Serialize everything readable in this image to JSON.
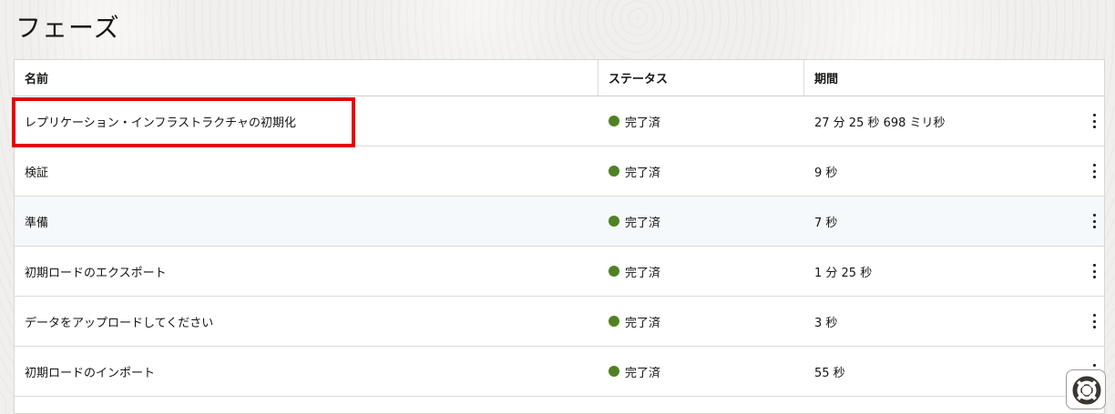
{
  "page": {
    "title": "フェーズ"
  },
  "table": {
    "columns": {
      "name": "名前",
      "status": "ステータス",
      "duration": "期間"
    },
    "rows": [
      {
        "name": "レプリケーション・インフラストラクチャの初期化",
        "status": "完了済",
        "duration": "27 分 25 秒 698 ミリ秒"
      },
      {
        "name": "検証",
        "status": "完了済",
        "duration": "9 秒"
      },
      {
        "name": "準備",
        "status": "完了済",
        "duration": "7 秒"
      },
      {
        "name": "初期ロードのエクスポート",
        "status": "完了済",
        "duration": "1 分 25 秒"
      },
      {
        "name": "データをアップロードしてください",
        "status": "完了済",
        "duration": "3 秒"
      },
      {
        "name": "初期ロードのインポート",
        "status": "完了済",
        "duration": "55 秒"
      }
    ]
  },
  "icons": {
    "row_menu": "kebab-menu-icon",
    "status": "status-complete-dot-icon",
    "help": "help-lifebuoy-icon"
  },
  "colors": {
    "status_complete": "#508223",
    "annotation_highlight": "#e50000",
    "hover_row": "#f5f9fb"
  }
}
